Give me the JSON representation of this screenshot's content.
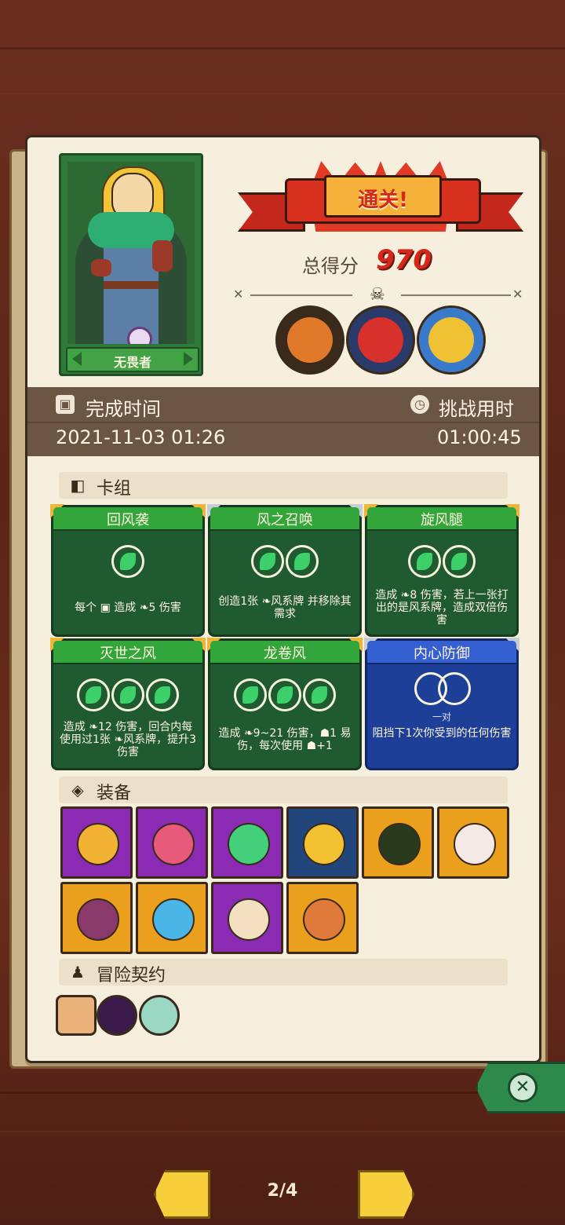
{
  "result": {
    "banner": "通关!",
    "score_label": "总得分",
    "score": "970"
  },
  "hero": {
    "name": "无畏者"
  },
  "bosses": [
    {
      "name": "boss-1",
      "color": "#e07a2a"
    },
    {
      "name": "boss-2",
      "color": "#d8302a"
    },
    {
      "name": "boss-3",
      "color": "#f0c233"
    }
  ],
  "stats": {
    "complete_time_label": "完成时间",
    "complete_time": "2021-11-03 01:26",
    "challenge_time_label": "挑战用时",
    "challenge_time": "01:00:45"
  },
  "deck": {
    "title": "卡组",
    "cards": [
      {
        "name": "回风袭",
        "cost": 1,
        "desc": "每个 ▣ 造成 ❧5 伤害"
      },
      {
        "name": "风之召唤",
        "cost": 2,
        "desc": "创造1张 ❧风系牌 并移除其需求"
      },
      {
        "name": "旋风腿",
        "cost": 2,
        "desc": "造成 ❧8 伤害，若上一张打出的是风系牌，造成双倍伤害"
      },
      {
        "name": "灭世之风",
        "cost": 3,
        "desc": "造成 ❧12 伤害，回合内每使用过1张 ❧风系牌，提升3伤害"
      },
      {
        "name": "龙卷风",
        "cost": 3,
        "desc": "造成 ❧9~21 伤害，☗1 易伤，每次使用 ☗+1"
      },
      {
        "name": "内心防御",
        "cost_label": "一对",
        "desc": "阻挡下1次你受到的任何伤害"
      }
    ]
  },
  "equipment": {
    "title": "装备",
    "items": [
      {
        "icon": "flame-shield-icon",
        "color": "purple"
      },
      {
        "icon": "spotted-shell-icon",
        "color": "purple"
      },
      {
        "icon": "wind-gem-icon",
        "color": "purple"
      },
      {
        "icon": "golden-helmet-icon",
        "color": "navy"
      },
      {
        "icon": "thorn-ring-icon",
        "color": "orange"
      },
      {
        "icon": "potion-jar-icon",
        "color": "orange"
      },
      {
        "icon": "cursed-heart-icon",
        "color": "orange"
      },
      {
        "icon": "crystal-shield-icon",
        "color": "orange"
      },
      {
        "icon": "sun-eye-icon",
        "color": "purple"
      },
      {
        "icon": "bronze-coin-icon",
        "color": "orange"
      }
    ]
  },
  "contracts": {
    "title": "冒险契约",
    "items": [
      "scroll-icon",
      "void-orb-icon",
      "potion-bag-icon"
    ]
  },
  "pagination": {
    "label": "2/4"
  }
}
